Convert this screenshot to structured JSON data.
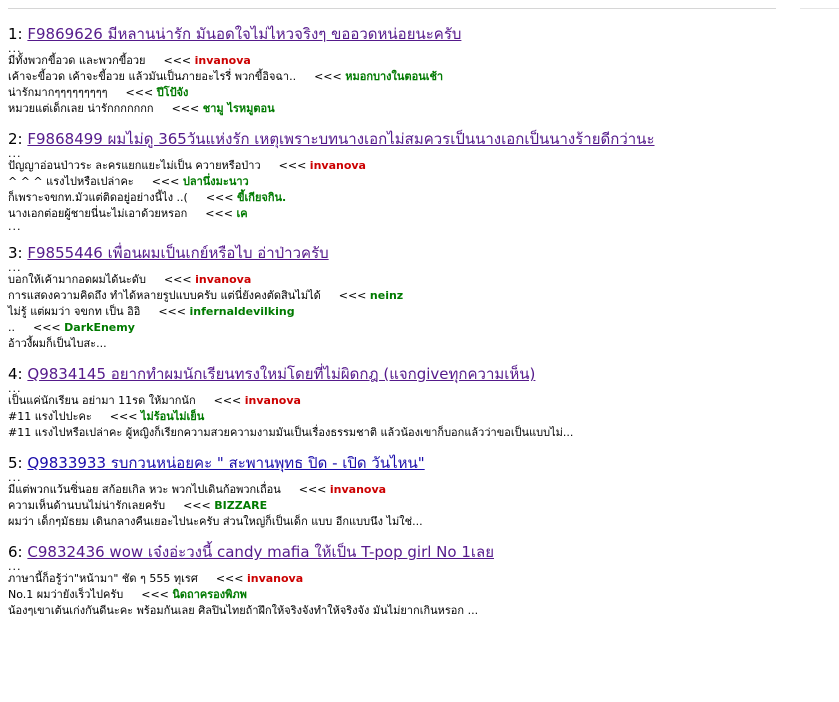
{
  "topics": [
    {
      "num": "1:",
      "title": "F9869626 มีหลานน่ารัก มันอดใจไม่ไหวจริงๆ ขออวดหน่อยนะครับ",
      "visited": true,
      "top_ellipsis": "...",
      "lines": [
        {
          "text": "มีทั้งพวกขี้อวด และพวกขี้อวย",
          "arrow": "<<<",
          "author": "invanova",
          "author_color": "red"
        },
        {
          "text": "เค้าจะขี้อวด เค้าจะขี้อวย แล้วมันเป็นภายอะไรรี่ พวกขี้อิจฉา..",
          "arrow": "<<<",
          "author": "หมอกบางในตอนเช้า",
          "author_color": "green"
        },
        {
          "text": "น่ารักมากๆๆๆๆๆๆๆๆๆ",
          "arrow": "<<<",
          "author": "ปีโป้จัง",
          "author_color": "green"
        },
        {
          "text": "หมวยแต่เด็กเลย น่ารักกกกกกก",
          "arrow": "<<<",
          "author": "ชามู ไรหมูตอน",
          "author_color": "green"
        }
      ],
      "bottom_ellipsis": ""
    },
    {
      "num": "2:",
      "title": "F9868499 ผมไม่ดู 365วันแห่งรัก เหตุเพราะบทนางเอกไม่สมควรเป็นนางเอกเป็นนางร้ายดีกว่านะ",
      "visited": true,
      "top_ellipsis": "...",
      "lines": [
        {
          "text": "ปัญญาอ่อนป่าวระ ละครแยกแยะไม่เป็น ควายหรือป่าว",
          "arrow": "<<<",
          "author": "invanova",
          "author_color": "red"
        },
        {
          "text": "^ ^ ^ แรงไปหรือเปล่าคะ",
          "arrow": "<<<",
          "author": "ปลานึ่งมะนาว",
          "author_color": "green"
        },
        {
          "text": "ก็เพราะจขกท.มัวแต่ติดอยู่อย่างนี้ไง ..(",
          "arrow": "<<<",
          "author": "ขี้เกียจกิน.",
          "author_color": "green"
        },
        {
          "text": "นางเอกต่อยผู้ชายนี่นะไม่เอาด้วยหรอก",
          "arrow": "<<<",
          "author": "เค",
          "author_color": "green"
        }
      ],
      "bottom_ellipsis": "..."
    },
    {
      "num": "3:",
      "title": "F9855446 เพื่อนผมเป็นเกย์หรือไบ อ่าป่าวครับ",
      "visited": true,
      "top_ellipsis": "...",
      "lines": [
        {
          "text": "บอกให้เค้ามากอดผมได้นะดับ",
          "arrow": "<<<",
          "author": "invanova",
          "author_color": "red"
        },
        {
          "text": "การแสดงความคิดถึง ทำได้หลายรูปแบบครับ แต่นี่ยังคงตัดสินไม่ได้",
          "arrow": "<<<",
          "author": "neinz",
          "author_color": "green"
        },
        {
          "text": "ไม่รู้ แต่ผมว่า จขกท เป็น อิอิ",
          "arrow": "<<<",
          "author": "infernaldevilking",
          "author_color": "green"
        },
        {
          "text": "..",
          "arrow": "<<<",
          "author": "DarkEnemy",
          "author_color": "green"
        },
        {
          "text": "อ้าวงี้ผมก็เป็นไบสะ...",
          "arrow": "",
          "author": "",
          "author_color": ""
        }
      ],
      "bottom_ellipsis": ""
    },
    {
      "num": "4:",
      "title": "Q9834145 อยากทำผมนักเรียนทรงใหม่โดยที่ไม่ผิดกฎ (แจกgiveทุกความเห็น)",
      "visited": true,
      "top_ellipsis": "...",
      "lines": [
        {
          "text": "เป็นแค่นักเรียน อย่ามา 11รด ให้มากนัก",
          "arrow": "<<<",
          "author": "invanova",
          "author_color": "red"
        },
        {
          "text": "#11 แรงไปปะคะ",
          "arrow": "<<<",
          "author": "ไม่ร้อนไม่เย็น",
          "author_color": "green"
        },
        {
          "text": "#11 แรงไปหรือเปล่าคะ ผู้หญิงก็เรียกความสวยความงามมันเป็นเรื่องธรรมชาติ แล้วน้องเขาก็บอกแล้วว่าขอเป็นแบบไม่...",
          "arrow": "",
          "author": "",
          "author_color": ""
        }
      ],
      "bottom_ellipsis": ""
    },
    {
      "num": "5:",
      "title": "Q9833933 รบกวนหน่อยคะ \" สะพานพุทธ ปิด - เปิด วันไหน\"",
      "visited": false,
      "top_ellipsis": "...",
      "lines": [
        {
          "text": "มีแต่พวกแว้นซิ่นอย สก้อยเกิล หวะ พวกไปเดินก้อพวกเถื่อน",
          "arrow": "<<<",
          "author": "invanova",
          "author_color": "red"
        },
        {
          "text": "ความเห็นด้านบนไม่น่ารักเลยครับ",
          "arrow": "<<<",
          "author": "BIZZARE",
          "author_color": "green"
        },
        {
          "text": "ผมว่า เด็กๆมัธยม เดินกลางคืนเยอะไปนะครับ ส่วนใหญ่ก็เป็นเด็ก แบบ อีกแบบนึง ไม่ใช่...",
          "arrow": "",
          "author": "",
          "author_color": ""
        }
      ],
      "bottom_ellipsis": ""
    },
    {
      "num": "6:",
      "title": "C9832436 wow เจ๋งอ่ะวงนี้ candy mafia ให้เป็น T-pop girl No 1เลย",
      "visited": true,
      "top_ellipsis": "...",
      "lines": [
        {
          "text": "ภาษานี้ก็อรู้ว่า\"หน้ามา\" ชัด ๆ 555 ทุเรศ",
          "arrow": "<<<",
          "author": "invanova",
          "author_color": "red"
        },
        {
          "text": "No.1 ผมว่ายังเร็วไปครับ",
          "arrow": "<<<",
          "author": "นิดถาครองพิภพ",
          "author_color": "green"
        },
        {
          "text": "น้องๆเขาเต้นเก่งกันดีนะคะ พร้อมกันเลย ศิลปินไทยถ้าฝึกให้จริงจังทำให้จริงจัง มันไม่ยากเกินหรอก ...",
          "arrow": "",
          "author": "",
          "author_color": ""
        }
      ],
      "bottom_ellipsis": ""
    }
  ]
}
